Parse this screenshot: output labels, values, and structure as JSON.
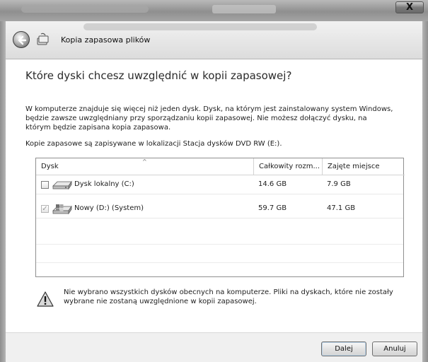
{
  "window": {
    "title": "Kopia zapasowa plików",
    "close_label": "X"
  },
  "page": {
    "heading": "Które dyski chcesz uwzględnić w kopii zapasowej?",
    "description": "W komputerze znajduje się więcej niż jeden dysk. Dysk, na którym jest zainstalowany system Windows, będzie zawsze uwzględniany przy sporządzaniu kopii zapasowej. Nie możesz dołączyć dysku, na którym będzie zapisana kopia zapasowa.",
    "location_note": "Kopie zapasowe są zapisywane w lokalizacji Stacja dysków DVD RW (E:)."
  },
  "table": {
    "columns": [
      "Dysk",
      "Całkowity rozm...",
      "Zajęte miejsce"
    ],
    "sort_indicator": "^",
    "rows": [
      {
        "name": "Dysk lokalny (C:)",
        "total": "14.6 GB",
        "used": "7.9 GB",
        "checked": false,
        "disabled": false,
        "icon": "hard-drive-icon"
      },
      {
        "name": "Nowy (D:) (System)",
        "total": "59.7 GB",
        "used": "47.1 GB",
        "checked": true,
        "disabled": true,
        "icon": "system-drive-icon"
      }
    ]
  },
  "warning": {
    "icon": "warning-icon",
    "text": "Nie wybrano wszystkich dysków obecnych na komputerze. Pliki na dyskach, które nie zostały wybrane nie zostaną uwzględnione w kopii zapasowej."
  },
  "buttons": {
    "next": "Dalej",
    "cancel": "Anuluj"
  }
}
